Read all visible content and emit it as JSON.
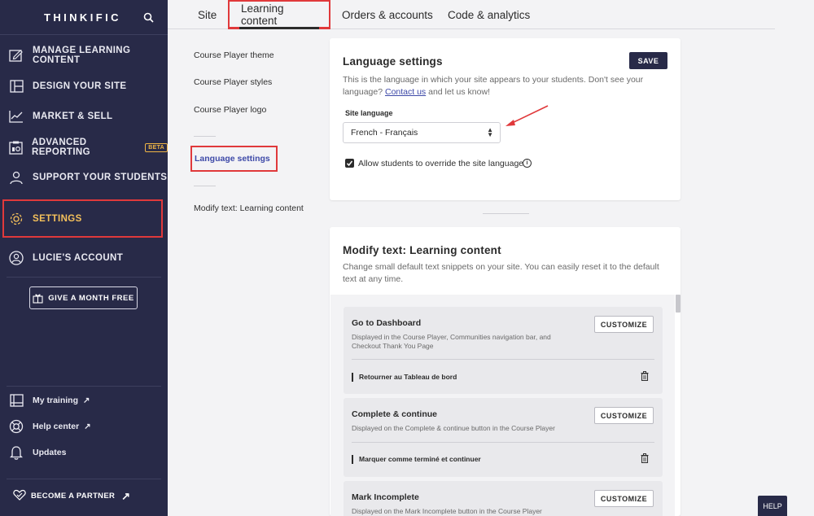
{
  "brand": {
    "logo_text": "THINKIFIC"
  },
  "sidebar": {
    "items": [
      {
        "label": "MANAGE LEARNING CONTENT",
        "icon": "edit-icon"
      },
      {
        "label": "DESIGN YOUR SITE",
        "icon": "layout-icon"
      },
      {
        "label": "MARKET & SELL",
        "icon": "chart-icon"
      },
      {
        "label": "ADVANCED REPORTING",
        "icon": "report-icon",
        "badge": "BETA"
      },
      {
        "label": "SUPPORT YOUR STUDENTS",
        "icon": "users-icon"
      },
      {
        "label": "SETTINGS",
        "icon": "gear-icon",
        "active": true
      },
      {
        "label": "LUCIE'S ACCOUNT",
        "icon": "user-icon"
      }
    ],
    "give_label": "GIVE A MONTH FREE",
    "links": [
      {
        "label": "My training",
        "icon": "book-icon",
        "external": "↗"
      },
      {
        "label": "Help center",
        "icon": "lifebuoy-icon",
        "external": "↗"
      },
      {
        "label": "Updates",
        "icon": "bell-icon",
        "external": ""
      }
    ],
    "partner_label": "BECOME A PARTNER",
    "partner_arrow": "↗"
  },
  "tabs": [
    {
      "label": "Site"
    },
    {
      "label": "Learning content",
      "active": true
    },
    {
      "label": "Orders & accounts"
    },
    {
      "label": "Code & analytics"
    }
  ],
  "subnav": {
    "items": [
      "Course Player theme",
      "Course Player styles",
      "Course Player logo"
    ],
    "active": "Language settings",
    "after": "Modify text: Learning content"
  },
  "language": {
    "title": "Language settings",
    "desc_before": "This is the language in which your site appears to your students. Don't see your language?",
    "desc_link": "Contact us",
    "desc_after": "and let us know!",
    "save_label": "SAVE",
    "field_label": "Site language",
    "selected": "French - Français",
    "override_label": "Allow students to override the site language",
    "override_checked": true,
    "info_glyph": "i"
  },
  "modify": {
    "title": "Modify text: Learning content",
    "desc": "Change small default text snippets on your site. You can easily reset it to the default text at any time.",
    "customize_label": "CUSTOMIZE",
    "items": [
      {
        "title": "Go to Dashboard",
        "desc": "Displayed in the Course Player, Communities navigation bar, and Checkout Thank You Page",
        "value": "Retourner au Tableau de bord"
      },
      {
        "title": "Complete & continue",
        "desc": "Displayed on the Complete & continue button in the Course Player",
        "value": "Marquer comme terminé et continuer"
      },
      {
        "title": "Mark Incomplete",
        "desc": "Displayed on the Mark Incomplete button in the Course Player",
        "value": ""
      }
    ]
  },
  "help_label": "HELP",
  "colors": {
    "sidebar_bg": "#282a48",
    "accent": "#3e4aa8",
    "highlight": "#e0393b",
    "settings_text": "#f5c15b"
  }
}
